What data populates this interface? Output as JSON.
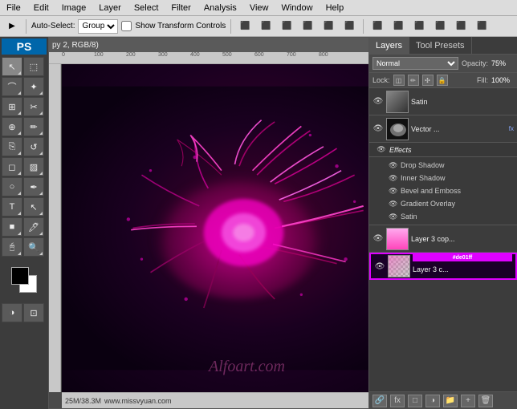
{
  "menubar": {
    "items": [
      "File",
      "Edit",
      "Image",
      "Layer",
      "Select",
      "Filter",
      "Analysis",
      "View",
      "Window",
      "Help"
    ]
  },
  "toolbar": {
    "move_tool_label": "▶",
    "auto_select_label": "Auto-Select:",
    "group_option": "Group",
    "show_transform_label": "Show Transform Controls",
    "align_icons": [
      "⬛",
      "⬛",
      "⬛",
      "⬛",
      "⬛",
      "⬛",
      "⬛",
      "⬛",
      "⬛",
      "⬛",
      "⬛",
      "⬛"
    ]
  },
  "ps_window": {
    "title": "py 2, RGB/8)",
    "win_btns": [
      "×",
      "—",
      "□"
    ]
  },
  "rulers": {
    "h_marks": [
      "0",
      "100",
      "200",
      "300",
      "400",
      "500",
      "600",
      "700",
      "800"
    ],
    "v_marks": []
  },
  "status_bar": {
    "text": "25M/38.3M",
    "url": "www.missvyuan.com"
  },
  "watermark": {
    "text": "Alfoart.com"
  },
  "layers_panel": {
    "tabs": [
      "Layers",
      "Tool Presets"
    ],
    "blend_mode": "Normal",
    "opacity_label": "Opacity:",
    "opacity_value": "75%",
    "lock_label": "Lock:",
    "fill_label": "Fill:",
    "fill_value": "100%",
    "layers": [
      {
        "name": "Satin",
        "visible": true,
        "type": "text",
        "has_fx": false,
        "thumb_class": ""
      },
      {
        "name": "Vector ...",
        "visible": true,
        "type": "vector",
        "has_fx": true,
        "thumb_class": "thumb-bw"
      },
      {
        "name": "Effects",
        "visible": true,
        "type": "effects-group",
        "has_fx": false,
        "thumb_class": ""
      }
    ],
    "effects": [
      "Drop Shadow",
      "Inner Shadow",
      "Bevel and Emboss",
      "Gradient Overlay",
      "Satin"
    ],
    "bottom_layers": [
      {
        "name": "Layer 3 cop...",
        "visible": true,
        "thumb_class": "thumb-pink-gradient",
        "active": false
      },
      {
        "name": "Layer 3 c...",
        "visible": true,
        "thumb_class": "thumb-checkered",
        "active": true,
        "color": "#de01ff"
      }
    ],
    "bottom_icons": [
      "🔗",
      "fx",
      "□",
      "🗑"
    ]
  }
}
